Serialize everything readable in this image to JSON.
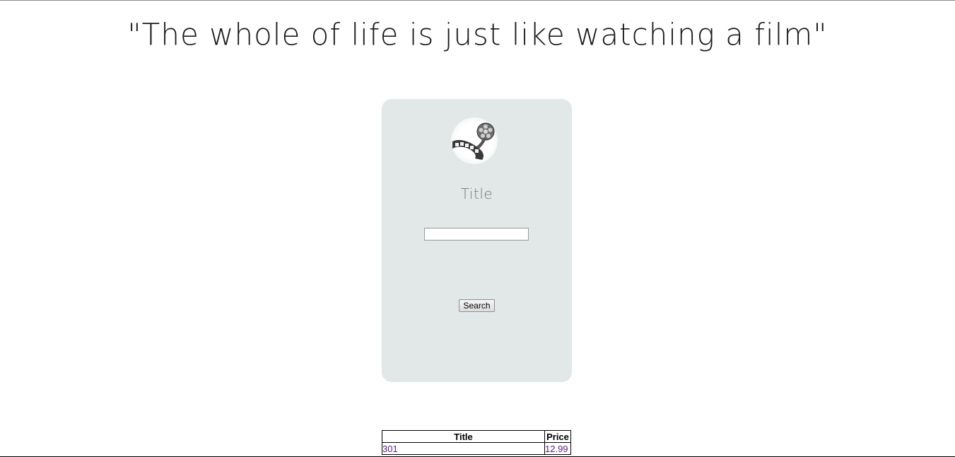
{
  "header": {
    "quote": "\"The whole of life is just like watching a film\""
  },
  "search_form": {
    "logo_icon": "film-reel-icon",
    "field_label": "Title",
    "title_input_value": "",
    "search_button_label": "Search"
  },
  "results_table": {
    "columns": [
      "Title",
      "Price"
    ],
    "rows": [
      {
        "title": "301",
        "price": "12.99"
      }
    ]
  }
}
